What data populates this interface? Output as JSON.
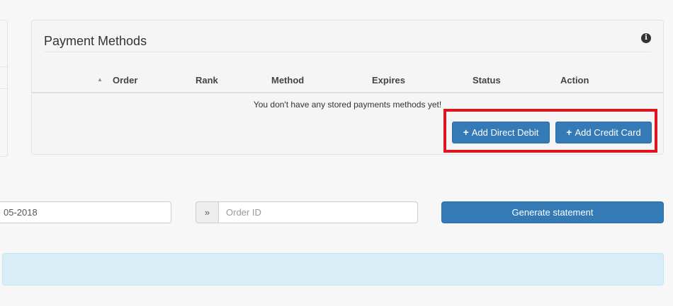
{
  "panel": {
    "title": "Payment Methods",
    "info_icon": "info-icon",
    "columns": [
      "Order",
      "Rank",
      "Method",
      "Expires",
      "Status",
      "Action"
    ],
    "sort_icon": "sort-up-icon",
    "empty_message": "You don't have any stored payments methods yet!",
    "add_direct_debit_label": "Add Direct Debit",
    "add_credit_card_label": "Add Credit Card",
    "plus_icon": "+",
    "highlight_color": "#e0141e"
  },
  "statement": {
    "date_value": "05-2018",
    "order_addon_icon": "»",
    "order_placeholder": "Order ID",
    "generate_label": "Generate statement"
  },
  "colors": {
    "primary": "#337ab7",
    "info_bg": "#d9edf7"
  }
}
